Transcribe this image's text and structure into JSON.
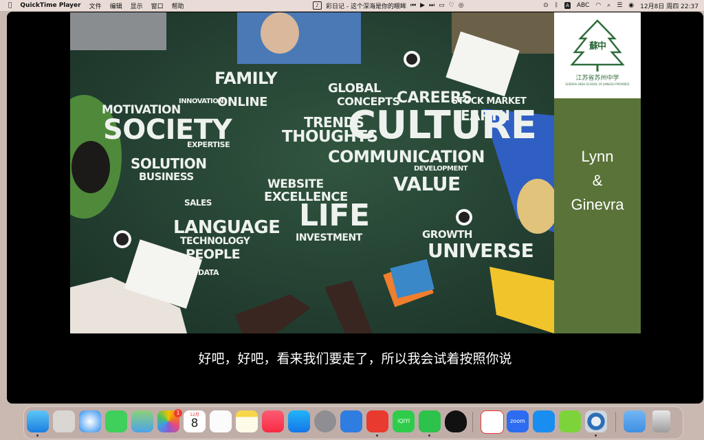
{
  "menubar": {
    "apple_icon": "apple-logo",
    "app_name": "QuickTime Player",
    "menus": [
      "文件",
      "编辑",
      "显示",
      "窗口",
      "帮助"
    ],
    "now_playing": "彩日记 - 这个深海是你的眼眸",
    "input_source": "ABC",
    "datetime": "12月8日 周四 22:37"
  },
  "slide": {
    "name_line1": "Lynn",
    "name_line2": "&",
    "name_line3": "Ginevra",
    "logo_glyph": "蘇中",
    "logo_caption": "江苏省苏州中学",
    "logo_sub": "SUZHOU HIGH SCHOOL OF JIANGSU PROVINCE"
  },
  "wordcloud": {
    "w1": "FAMILY",
    "w2": "SOCIETY",
    "w3": "MOTIVATION",
    "w4": "ONLINE",
    "w5": "GLOBAL",
    "w6": "CONCEPTS",
    "w7": "CAREERS",
    "w8": "STOCK MARKET",
    "w9": "CULTURE",
    "w10": "TRENDS",
    "w11": "THOUGHTS",
    "w12": "EARTH",
    "w13": "COMMUNICATION",
    "w14": "SOLUTION",
    "w15": "BUSINESS",
    "w16": "EXPERTISE",
    "w17": "WEBSITE",
    "w18": "VALUE",
    "w19": "EXCELLENCE",
    "w20": "LIFE",
    "w21": "LANGUAGE",
    "w22": "TECHNOLOGY",
    "w23": "PEOPLE",
    "w24": "INVESTMENT",
    "w25": "GROWTH",
    "w26": "UNIVERSE",
    "w27": "SALES",
    "w28": "DEVELOPMENT",
    "w29": "INNOVATION",
    "w30": "DATA"
  },
  "subtitle": "好吧，好吧，看来我们要走了，所以我会试着按照你说",
  "dock": {
    "calendar_month": "12月",
    "calendar_day": "8",
    "photos_badge": "1",
    "iqiyi_label": "iQIYI",
    "zoom_label": "zoom"
  },
  "colors": {
    "board": "#264536",
    "name_panel": "#5a7339",
    "logo_green": "#2e6b3b"
  }
}
